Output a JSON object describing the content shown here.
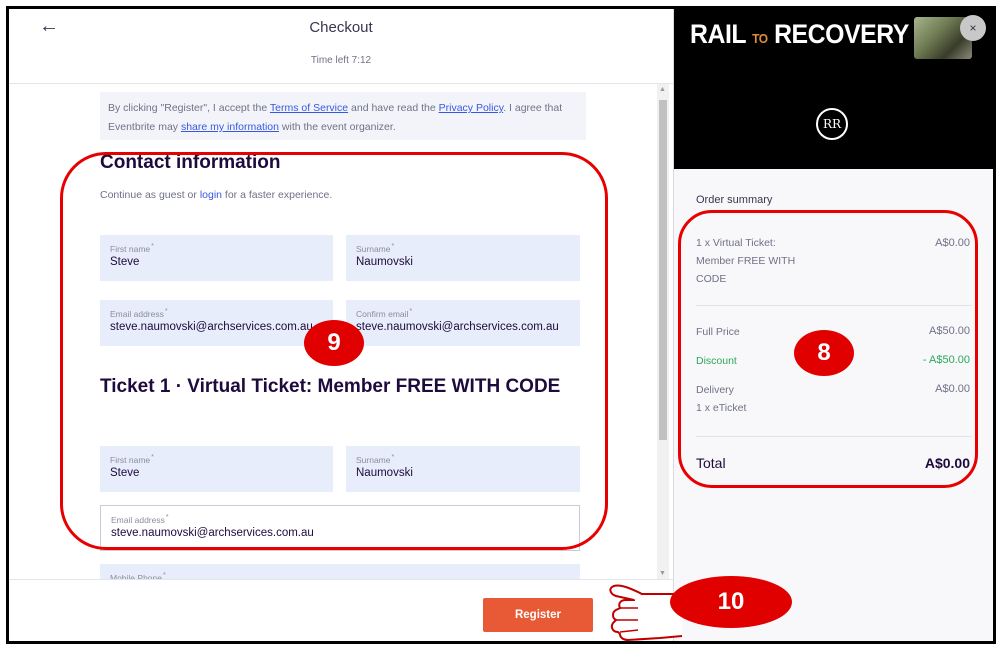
{
  "header": {
    "title": "Checkout",
    "timer": "Time left 7:12"
  },
  "terms": {
    "t1": "By clicking \"Register\", I accept the ",
    "link1": "Terms of Service",
    "t2": " and have read the ",
    "link2": "Privacy Policy",
    "t3": ". I agree that Eventbrite may ",
    "link3": "share my information",
    "t4": " with the event organizer."
  },
  "contact": {
    "heading": "Contact information",
    "sub_prefix": "Continue as guest or ",
    "login_link": "login",
    "sub_suffix": " for a faster experience.",
    "first_name_label": "First name",
    "first_name": "Steve",
    "surname_label": "Surname",
    "surname": "Naumovski",
    "email_label": "Email address",
    "email": "steve.naumovski@archservices.com.au",
    "confirm_label": "Confirm email",
    "confirm": "steve.naumovski@archservices.com.au"
  },
  "ticket": {
    "heading": "Ticket 1 · Virtual Ticket: Member FREE WITH CODE",
    "first_name_label": "First name",
    "first_name": "Steve",
    "surname_label": "Surname",
    "surname": "Naumovski",
    "email_label": "Email address",
    "email": "steve.naumovski@archservices.com.au",
    "phone_label": "Mobile Phone"
  },
  "footer": {
    "register_label": "Register"
  },
  "banner": {
    "rail": "RAIL",
    "to": "TO",
    "recovery": "RECOVERY",
    "logo_text": "RR",
    "close_glyph": "×"
  },
  "summary": {
    "title": "Order summary",
    "item_line1": "1 x Virtual Ticket:",
    "item_line2": "Member FREE WITH",
    "item_line3": "CODE",
    "item_amount": "A$0.00",
    "full_price_label": "Full Price",
    "full_price": "A$50.00",
    "discount_label": "Discount",
    "discount": "- A$50.00",
    "delivery_label": "Delivery",
    "delivery_sub": "1 x eTicket",
    "delivery": "A$0.00",
    "total_label": "Total",
    "total": "A$0.00"
  },
  "annotations": {
    "badge_9": "9",
    "badge_8": "8",
    "badge_10": "10",
    "ring_color": "#e80000"
  },
  "colors": {
    "accent": "#e85a36",
    "link": "#3659e3",
    "field_bg": "#e7edfb",
    "discount": "#2ca85a"
  },
  "icons": {
    "back": "arrow-left-icon",
    "close": "close-icon",
    "pointer": "hand-pointer-icon"
  }
}
